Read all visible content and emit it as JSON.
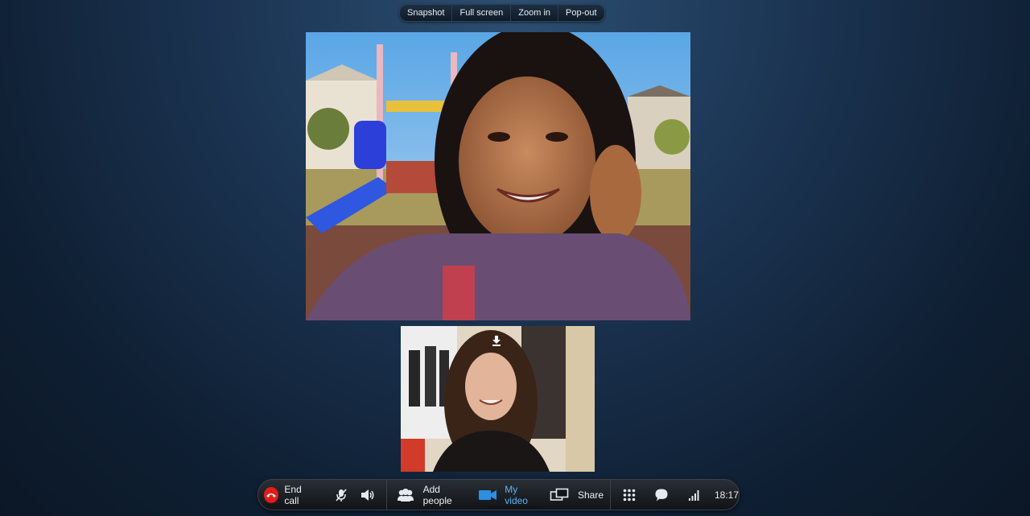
{
  "top_toolbar": {
    "snapshot": "Snapshot",
    "full_screen": "Full screen",
    "zoom_in": "Zoom in",
    "pop_out": "Pop-out"
  },
  "call_bar": {
    "end_call": "End call",
    "add_people": "Add people",
    "my_video": "My video",
    "share": "Share",
    "time": "18:17"
  },
  "colors": {
    "end_call_red": "#e21b1b",
    "my_video_blue": "#5fb3f0",
    "background": "#1d3756"
  },
  "icons": {
    "end_call": "phone-hangup-icon",
    "mute": "mic-muted-icon",
    "speaker": "speaker-icon",
    "add_people": "people-icon",
    "my_video": "video-camera-icon",
    "share": "screen-share-icon",
    "dialpad": "dialpad-icon",
    "chat": "chat-bubble-icon",
    "signal": "signal-strength-icon",
    "download": "download-icon"
  }
}
